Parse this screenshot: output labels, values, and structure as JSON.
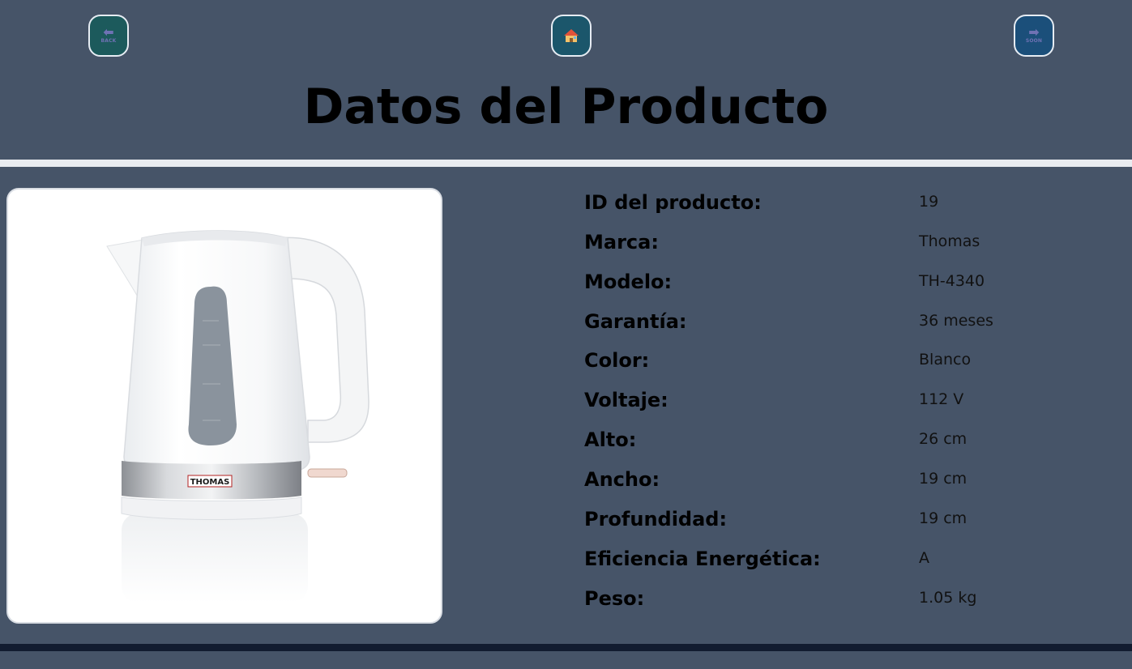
{
  "nav": {
    "back_text": "BACK",
    "next_text": "SOON"
  },
  "title": "Datos del Producto",
  "product_image": {
    "brand_mark": "THOMAS"
  },
  "specs": [
    {
      "label": "ID del producto:",
      "value": "19"
    },
    {
      "label": "Marca:",
      "value": "Thomas"
    },
    {
      "label": "Modelo:",
      "value": "TH-4340"
    },
    {
      "label": "Garantía:",
      "value": "36 meses"
    },
    {
      "label": "Color:",
      "value": "Blanco"
    },
    {
      "label": "Voltaje:",
      "value": "112 V"
    },
    {
      "label": "Alto:",
      "value": "26 cm"
    },
    {
      "label": "Ancho:",
      "value": "19 cm"
    },
    {
      "label": "Profundidad:",
      "value": "19 cm"
    },
    {
      "label": "Eficiencia Energética:",
      "value": "A"
    },
    {
      "label": "Peso:",
      "value": "1.05 kg"
    }
  ]
}
